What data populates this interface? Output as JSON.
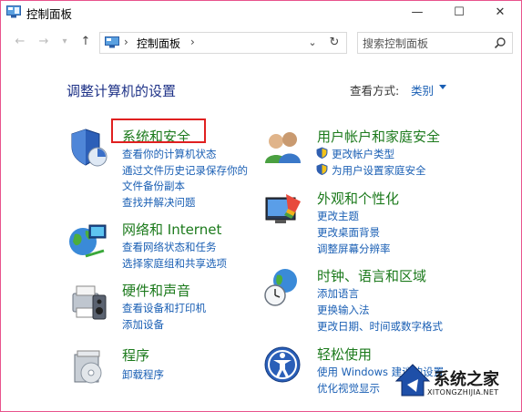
{
  "window": {
    "title": "控制面板",
    "minimize": "—",
    "maximize": "☐",
    "close": "✕"
  },
  "nav": {
    "back": "←",
    "forward": "→",
    "recent": "▾",
    "up": "↑",
    "address": "控制面板",
    "address_arrow": "›",
    "dropdown": "⌄",
    "refresh": "↻",
    "search_placeholder": "搜索控制面板"
  },
  "main": {
    "heading": "调整计算机的设置",
    "view_by_label": "查看方式:",
    "view_by_value": "类别"
  },
  "categories_left": [
    {
      "title": "系统和安全",
      "links": [
        "查看你的计算机状态",
        "通过文件历史记录保存你的",
        "文件备份副本",
        "查找并解决问题"
      ]
    },
    {
      "title": "网络和 Internet",
      "links": [
        "查看网络状态和任务",
        "选择家庭组和共享选项"
      ]
    },
    {
      "title": "硬件和声音",
      "links": [
        "查看设备和打印机",
        "添加设备"
      ]
    },
    {
      "title": "程序",
      "links": [
        "卸载程序"
      ]
    }
  ],
  "categories_right": [
    {
      "title": "用户帐户和家庭安全",
      "links": [
        "更改帐户类型",
        "为用户设置家庭安全"
      ]
    },
    {
      "title": "外观和个性化",
      "links": [
        "更改主题",
        "更改桌面背景",
        "调整屏幕分辨率"
      ]
    },
    {
      "title": "时钟、语言和区域",
      "links": [
        "添加语言",
        "更换输入法",
        "更改日期、时间或数字格式"
      ]
    },
    {
      "title": "轻松使用",
      "links": [
        "使用 Windows 建议的设置",
        "优化视觉显示"
      ]
    }
  ],
  "watermark": {
    "brand": "系统之家",
    "domain": "XITONGZHIJIA.NET"
  }
}
